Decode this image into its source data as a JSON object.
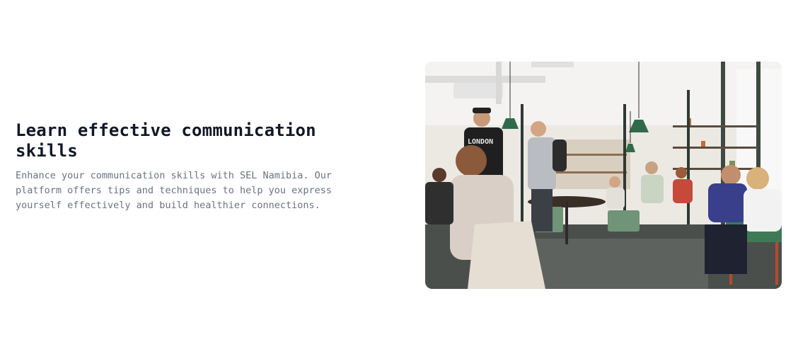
{
  "feature": {
    "heading": "Learn effective communication skills",
    "description": "Enhance your communication skills with SEL Namibia. Our platform offers tips and techniques to help you express yourself effectively and build healthier connections.",
    "image": {
      "subject": "cafe-interior-photo",
      "shirt_text": "LONDON"
    }
  },
  "colors": {
    "heading": "#111827",
    "body": "#6b7280",
    "background": "#ffffff"
  }
}
